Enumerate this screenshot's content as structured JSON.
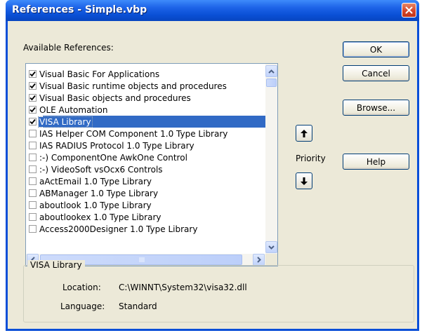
{
  "window": {
    "title": "References - Simple.vbp"
  },
  "labels": {
    "available_references": "Available References:",
    "priority": "Priority"
  },
  "buttons": {
    "ok": "OK",
    "cancel": "Cancel",
    "browse": "Browse...",
    "help": "Help"
  },
  "references": [
    {
      "label": "Visual Basic For Applications",
      "checked": true,
      "selected": false
    },
    {
      "label": "Visual Basic runtime objects and procedures",
      "checked": true,
      "selected": false
    },
    {
      "label": "Visual Basic objects and procedures",
      "checked": true,
      "selected": false
    },
    {
      "label": "OLE Automation",
      "checked": true,
      "selected": false
    },
    {
      "label": "VISA Library",
      "checked": true,
      "selected": true
    },
    {
      "label": "IAS Helper COM Component 1.0 Type Library",
      "checked": false,
      "selected": false
    },
    {
      "label": "IAS RADIUS Protocol 1.0 Type Library",
      "checked": false,
      "selected": false
    },
    {
      "label": ":-) ComponentOne AwkOne Control",
      "checked": false,
      "selected": false
    },
    {
      "label": ":-) VideoSoft vsOcx6 Controls",
      "checked": false,
      "selected": false
    },
    {
      "label": "aActEmail 1.0 Type Library",
      "checked": false,
      "selected": false
    },
    {
      "label": "ABManager 1.0 Type Library",
      "checked": false,
      "selected": false
    },
    {
      "label": "aboutlook 1.0 Type Library",
      "checked": false,
      "selected": false
    },
    {
      "label": "aboutlookex 1.0 Type Library",
      "checked": false,
      "selected": false
    },
    {
      "label": "Access2000Designer 1.0 Type Library",
      "checked": false,
      "selected": false
    }
  ],
  "details": {
    "group_title": "VISA Library",
    "location_label": "Location:",
    "location_value": "C:\\WINNT\\System32\\visa32.dll",
    "language_label": "Language:",
    "language_value": "Standard"
  }
}
